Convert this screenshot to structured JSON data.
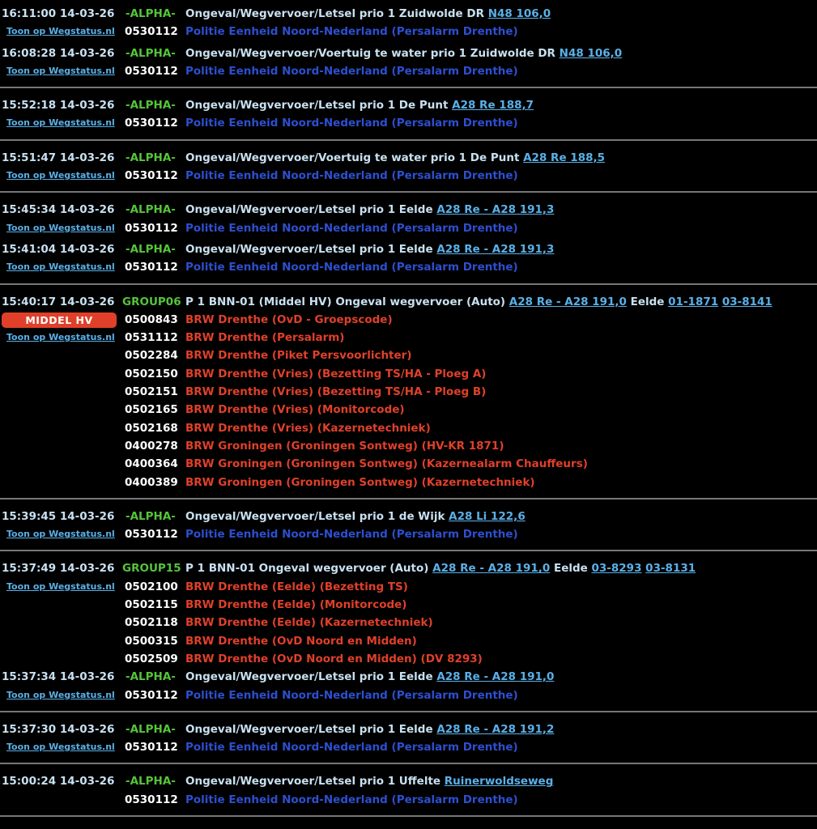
{
  "colors": {
    "background": "#000000",
    "timestamp": "#c8e0f0",
    "group_green": "#55c43a",
    "link_blue": "#5ab0e8",
    "police_blue": "#2d4fd0",
    "fire_red": "#e0402a",
    "separator": "#777777"
  },
  "link_text": "Toon op Wegstatus.nl",
  "messages": [
    {
      "time": "16:11:00 14-03-26",
      "group": "-ALPHA-",
      "text": "Ongeval/Wegvervoer/Letsel prio 1 Zuidwolde DR",
      "road": "N48 106,0",
      "code": "0530112",
      "org": "Politie Eenheid Noord-Nederland (Persalarm Drenthe)"
    },
    {
      "time": "16:08:28 14-03-26",
      "group": "-ALPHA-",
      "text": "Ongeval/Wegvervoer/Voertuig te water prio 1 Zuidwolde DR",
      "road": "N48 106,0",
      "code": "0530112",
      "org": "Politie Eenheid Noord-Nederland (Persalarm Drenthe)"
    },
    {
      "time": "15:52:18 14-03-26",
      "group": "-ALPHA-",
      "text": "Ongeval/Wegvervoer/Letsel prio 1 De Punt",
      "road": "A28 Re 188,7",
      "code": "0530112",
      "org": "Politie Eenheid Noord-Nederland (Persalarm Drenthe)"
    },
    {
      "time": "15:51:47 14-03-26",
      "group": "-ALPHA-",
      "text": "Ongeval/Wegvervoer/Voertuig te water prio 1 De Punt",
      "road": "A28 Re 188,5",
      "code": "0530112",
      "org": "Politie Eenheid Noord-Nederland (Persalarm Drenthe)"
    },
    {
      "time": "15:45:34 14-03-26",
      "group": "-ALPHA-",
      "text": "Ongeval/Wegvervoer/Letsel prio 1 Eelde",
      "road": "A28 Re - A28 191,3",
      "code": "0530112",
      "org": "Politie Eenheid Noord-Nederland (Persalarm Drenthe)"
    },
    {
      "time": "15:41:04 14-03-26",
      "group": "-ALPHA-",
      "text": "Ongeval/Wegvervoer/Letsel prio 1 Eelde",
      "road": "A28 Re - A28 191,3",
      "code": "0530112",
      "org": "Politie Eenheid Noord-Nederland (Persalarm Drenthe)"
    },
    {
      "time": "15:40:17 14-03-26",
      "group": "GROUP06",
      "text": "P 1 BNN-01 (Middel HV) Ongeval wegvervoer (Auto)",
      "road": "A28 Re - A28 191,0",
      "place": "Eelde",
      "extra1": "01-1871",
      "extra2": "03-8141",
      "badge": "MIDDEL HV",
      "units": [
        {
          "code": "0500843",
          "org": "BRW Drenthe (OvD - Groepscode)"
        },
        {
          "code": "0531112",
          "org": "BRW Drenthe (Persalarm)"
        },
        {
          "code": "0502284",
          "org": "BRW Drenthe (Piket Persvoorlichter)"
        },
        {
          "code": "0502150",
          "org": "BRW Drenthe (Vries) (Bezetting TS/HA - Ploeg A)"
        },
        {
          "code": "0502151",
          "org": "BRW Drenthe (Vries) (Bezetting TS/HA - Ploeg B)"
        },
        {
          "code": "0502165",
          "org": "BRW Drenthe (Vries) (Monitorcode)"
        },
        {
          "code": "0502168",
          "org": "BRW Drenthe (Vries) (Kazernetechniek)"
        },
        {
          "code": "0400278",
          "org": "BRW Groningen (Groningen Sontweg) (HV-KR 1871)"
        },
        {
          "code": "0400364",
          "org": "BRW Groningen (Groningen Sontweg) (Kazernealarm Chauffeurs)"
        },
        {
          "code": "0400389",
          "org": "BRW Groningen (Groningen Sontweg) (Kazernetechniek)"
        }
      ]
    },
    {
      "time": "15:39:45 14-03-26",
      "group": "-ALPHA-",
      "text": "Ongeval/Wegvervoer/Letsel prio 1 de Wijk",
      "road": "A28 Li 122,6",
      "code": "0530112",
      "org": "Politie Eenheid Noord-Nederland (Persalarm Drenthe)"
    },
    {
      "time": "15:37:49 14-03-26",
      "group": "GROUP15",
      "text": "P 1 BNN-01 Ongeval wegvervoer (Auto)",
      "road": "A28 Re - A28 191,0",
      "place": "Eelde",
      "extra1": "03-8293",
      "extra2": "03-8131",
      "units": [
        {
          "code": "0502100",
          "org": "BRW Drenthe (Eelde) (Bezetting TS)"
        },
        {
          "code": "0502115",
          "org": "BRW Drenthe (Eelde) (Monitorcode)"
        },
        {
          "code": "0502118",
          "org": "BRW Drenthe (Eelde) (Kazernetechniek)"
        },
        {
          "code": "0500315",
          "org": "BRW Drenthe (OvD Noord en Midden)"
        },
        {
          "code": "0502509",
          "org": "BRW Drenthe (OvD Noord en Midden) (DV 8293)"
        }
      ]
    },
    {
      "time": "15:37:34 14-03-26",
      "group": "-ALPHA-",
      "text": "Ongeval/Wegvervoer/Letsel prio 1 Eelde",
      "road": "A28 Re - A28 191,0",
      "code": "0530112",
      "org": "Politie Eenheid Noord-Nederland (Persalarm Drenthe)"
    },
    {
      "time": "15:37:30 14-03-26",
      "group": "-ALPHA-",
      "text": "Ongeval/Wegvervoer/Letsel prio 1 Eelde",
      "road": "A28 Re - A28 191,2",
      "code": "0530112",
      "org": "Politie Eenheid Noord-Nederland (Persalarm Drenthe)"
    },
    {
      "time": "15:00:24 14-03-26",
      "group": "-ALPHA-",
      "text": "Ongeval/Wegvervoer/Letsel prio 1 Uffelte",
      "road": "Ruinerwoldseweg",
      "code": "0530112",
      "org": "Politie Eenheid Noord-Nederland (Persalarm Drenthe)",
      "no_link": true
    }
  ]
}
